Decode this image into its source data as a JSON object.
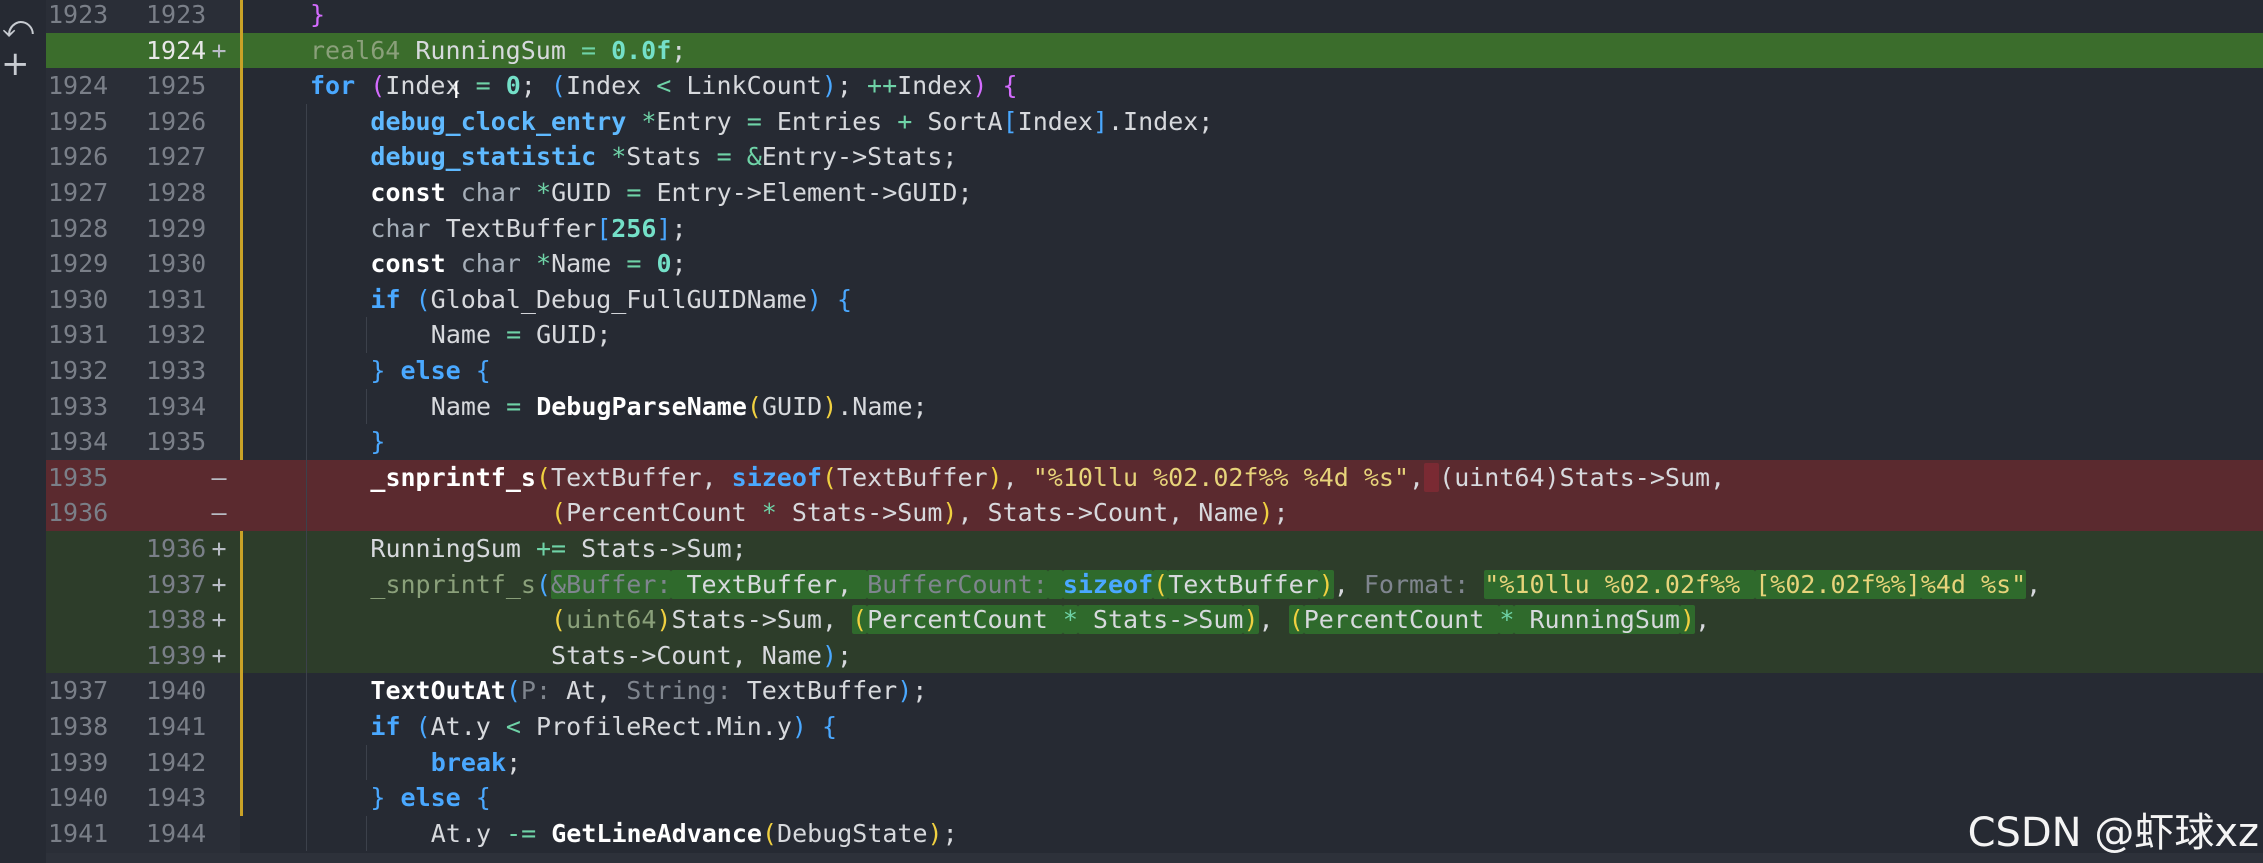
{
  "watermark": "CSDN @虾球xz",
  "icons": {
    "undo": "undo-icon",
    "add": "plus-icon",
    "text_cursor": "text-cursor-icon"
  },
  "colors": {
    "background": "#262a33",
    "added_line": "#2d3d2a",
    "added_line_active": "#3b6d2c",
    "removed_line": "#5b2a2f",
    "change_marker": "#c9a227",
    "keyword": "#4aa8ff",
    "string": "#e7d37a",
    "number": "#74e0c8"
  },
  "lines": [
    {
      "old": "1923",
      "new": "1923",
      "marker": "",
      "type": "context",
      "indent": 1,
      "tokens": [
        {
          "t": "}",
          "c": "par2"
        }
      ]
    },
    {
      "old": "",
      "new": "1924",
      "marker": "+",
      "type": "added-strong",
      "indent": 1,
      "cur": true,
      "tokens": [
        {
          "t": "real64",
          "c": "dim"
        },
        {
          "t": " RunningSum ",
          "c": "plain"
        },
        {
          "t": "=",
          "c": "op"
        },
        {
          "t": " ",
          "c": "plain"
        },
        {
          "t": "0.0f",
          "c": "num"
        },
        {
          "t": ";",
          "c": "plain"
        }
      ]
    },
    {
      "old": "1924",
      "new": "1925",
      "marker": "",
      "type": "context",
      "indent": 1,
      "tokens": [
        {
          "t": "for",
          "c": "kwb"
        },
        {
          "t": " ",
          "c": "plain"
        },
        {
          "t": "(",
          "c": "par2"
        },
        {
          "t": "Index ",
          "c": "plain"
        },
        {
          "t": "=",
          "c": "op"
        },
        {
          "t": " ",
          "c": "plain"
        },
        {
          "t": "0",
          "c": "num"
        },
        {
          "t": "; ",
          "c": "plain"
        },
        {
          "t": "(",
          "c": "brk"
        },
        {
          "t": "Index ",
          "c": "plain"
        },
        {
          "t": "<",
          "c": "op"
        },
        {
          "t": " LinkCount",
          "c": "plain"
        },
        {
          "t": ")",
          "c": "brk"
        },
        {
          "t": "; ",
          "c": "plain"
        },
        {
          "t": "++",
          "c": "op"
        },
        {
          "t": "Index",
          "c": "plain"
        },
        {
          "t": ")",
          "c": "par2"
        },
        {
          "t": " ",
          "c": "plain"
        },
        {
          "t": "{",
          "c": "par2"
        }
      ]
    },
    {
      "old": "1925",
      "new": "1926",
      "marker": "",
      "type": "context",
      "indent": 2,
      "tokens": [
        {
          "t": "debug_clock_entry",
          "c": "type"
        },
        {
          "t": " ",
          "c": "plain"
        },
        {
          "t": "*",
          "c": "op"
        },
        {
          "t": "Entry ",
          "c": "plain"
        },
        {
          "t": "=",
          "c": "op"
        },
        {
          "t": " Entries ",
          "c": "plain"
        },
        {
          "t": "+",
          "c": "op"
        },
        {
          "t": " SortA",
          "c": "plain"
        },
        {
          "t": "[",
          "c": "brk"
        },
        {
          "t": "Index",
          "c": "plain"
        },
        {
          "t": "]",
          "c": "brk"
        },
        {
          "t": ".Index;",
          "c": "plain"
        }
      ]
    },
    {
      "old": "1926",
      "new": "1927",
      "marker": "",
      "type": "context",
      "indent": 2,
      "tokens": [
        {
          "t": "debug_statistic",
          "c": "type"
        },
        {
          "t": " ",
          "c": "plain"
        },
        {
          "t": "*",
          "c": "op"
        },
        {
          "t": "Stats ",
          "c": "plain"
        },
        {
          "t": "=",
          "c": "op"
        },
        {
          "t": " ",
          "c": "plain"
        },
        {
          "t": "&",
          "c": "op"
        },
        {
          "t": "Entry->Stats;",
          "c": "plain"
        }
      ]
    },
    {
      "old": "1927",
      "new": "1928",
      "marker": "",
      "type": "context",
      "indent": 2,
      "tokens": [
        {
          "t": "const",
          "c": "fn"
        },
        {
          "t": " ",
          "c": "plain"
        },
        {
          "t": "char",
          "c": "sub"
        },
        {
          "t": " ",
          "c": "plain"
        },
        {
          "t": "*",
          "c": "op"
        },
        {
          "t": "GUID ",
          "c": "plain"
        },
        {
          "t": "=",
          "c": "op"
        },
        {
          "t": " Entry->Element->GUID;",
          "c": "plain"
        }
      ]
    },
    {
      "old": "1928",
      "new": "1929",
      "marker": "",
      "type": "context",
      "indent": 2,
      "tokens": [
        {
          "t": "char",
          "c": "sub"
        },
        {
          "t": " TextBuffer",
          "c": "plain"
        },
        {
          "t": "[",
          "c": "brk"
        },
        {
          "t": "256",
          "c": "num"
        },
        {
          "t": "]",
          "c": "brk"
        },
        {
          "t": ";",
          "c": "plain"
        }
      ]
    },
    {
      "old": "1929",
      "new": "1930",
      "marker": "",
      "type": "context",
      "indent": 2,
      "tokens": [
        {
          "t": "const",
          "c": "fn"
        },
        {
          "t": " ",
          "c": "plain"
        },
        {
          "t": "char",
          "c": "sub"
        },
        {
          "t": " ",
          "c": "plain"
        },
        {
          "t": "*",
          "c": "op"
        },
        {
          "t": "Name ",
          "c": "plain"
        },
        {
          "t": "=",
          "c": "op"
        },
        {
          "t": " ",
          "c": "plain"
        },
        {
          "t": "0",
          "c": "num"
        },
        {
          "t": ";",
          "c": "plain"
        }
      ]
    },
    {
      "old": "1930",
      "new": "1931",
      "marker": "",
      "type": "context",
      "indent": 2,
      "tokens": [
        {
          "t": "if",
          "c": "kwb"
        },
        {
          "t": " ",
          "c": "plain"
        },
        {
          "t": "(",
          "c": "brk"
        },
        {
          "t": "Global_Debug_FullGUIDName",
          "c": "plain"
        },
        {
          "t": ")",
          "c": "brk"
        },
        {
          "t": " ",
          "c": "plain"
        },
        {
          "t": "{",
          "c": "brk"
        }
      ]
    },
    {
      "old": "1931",
      "new": "1932",
      "marker": "",
      "type": "context",
      "indent": 3,
      "tokens": [
        {
          "t": "Name ",
          "c": "plain"
        },
        {
          "t": "=",
          "c": "op"
        },
        {
          "t": " GUID;",
          "c": "plain"
        }
      ]
    },
    {
      "old": "1932",
      "new": "1933",
      "marker": "",
      "type": "context",
      "indent": 2,
      "tokens": [
        {
          "t": "}",
          "c": "brk"
        },
        {
          "t": " ",
          "c": "plain"
        },
        {
          "t": "else",
          "c": "kwb"
        },
        {
          "t": " ",
          "c": "plain"
        },
        {
          "t": "{",
          "c": "brk"
        }
      ]
    },
    {
      "old": "1933",
      "new": "1934",
      "marker": "",
      "type": "context",
      "indent": 3,
      "tokens": [
        {
          "t": "Name ",
          "c": "plain"
        },
        {
          "t": "=",
          "c": "op"
        },
        {
          "t": " ",
          "c": "plain"
        },
        {
          "t": "DebugParseName",
          "c": "fn"
        },
        {
          "t": "(",
          "c": "par"
        },
        {
          "t": "GUID",
          "c": "plain"
        },
        {
          "t": ")",
          "c": "par"
        },
        {
          "t": ".Name;",
          "c": "plain"
        }
      ]
    },
    {
      "old": "1934",
      "new": "1935",
      "marker": "",
      "type": "context",
      "indent": 2,
      "tokens": [
        {
          "t": "}",
          "c": "brk"
        }
      ]
    },
    {
      "old": "1935",
      "new": "",
      "marker": "—",
      "type": "removed",
      "indent": 2,
      "tokens": [
        {
          "t": "_snprintf_s",
          "c": "fn"
        },
        {
          "t": "(",
          "c": "par"
        },
        {
          "t": "TextBuffer, ",
          "c": "plain"
        },
        {
          "t": "sizeof",
          "c": "kwb"
        },
        {
          "t": "(",
          "c": "par"
        },
        {
          "t": "TextBuffer",
          "c": "plain"
        },
        {
          "t": ")",
          "c": "par"
        },
        {
          "t": ", ",
          "c": "plain"
        },
        {
          "t": "\"%10llu %02.02f%% %4d %s\"",
          "c": "str"
        },
        {
          "t": ",",
          "c": "plain"
        },
        {
          "t": " ",
          "c": "plain",
          "hl": "r"
        },
        {
          "t": "(uint64)Stats->Sum,",
          "c": "plain"
        }
      ]
    },
    {
      "old": "1936",
      "new": "",
      "marker": "—",
      "type": "removed",
      "indent": 2,
      "tokens": [
        {
          "t": "            ",
          "c": "plain"
        },
        {
          "t": "(",
          "c": "par"
        },
        {
          "t": "PercentCount ",
          "c": "plain"
        },
        {
          "t": "*",
          "c": "op"
        },
        {
          "t": " Stats->Sum",
          "c": "plain"
        },
        {
          "t": ")",
          "c": "par"
        },
        {
          "t": ", Stats->Count, Name",
          "c": "plain"
        },
        {
          "t": ")",
          "c": "par"
        },
        {
          "t": ";",
          "c": "plain"
        }
      ]
    },
    {
      "old": "",
      "new": "1936",
      "marker": "+",
      "type": "added",
      "indent": 2,
      "tokens": [
        {
          "t": "RunningSum ",
          "c": "plain"
        },
        {
          "t": "+=",
          "c": "op"
        },
        {
          "t": " Stats->Sum;",
          "c": "plain"
        }
      ]
    },
    {
      "old": "",
      "new": "1937",
      "marker": "+",
      "type": "added",
      "indent": 2,
      "tokens": [
        {
          "t": "_snprintf_s",
          "c": "dim"
        },
        {
          "t": "(",
          "c": "brk"
        },
        {
          "t": "&Buffer:",
          "c": "hint",
          "hl": "g"
        },
        {
          "t": " TextBuffer, ",
          "c": "plain",
          "hl": "g"
        },
        {
          "t": "BufferCount:",
          "c": "hint",
          "hl": "g"
        },
        {
          "t": " ",
          "c": "plain",
          "hl": "g"
        },
        {
          "t": "sizeof",
          "c": "kwb",
          "hl": "g"
        },
        {
          "t": "(",
          "c": "par",
          "hl": "g"
        },
        {
          "t": "TextBuffer",
          "c": "plain",
          "hl": "g"
        },
        {
          "t": ")",
          "c": "par",
          "hl": "g"
        },
        {
          "t": ", ",
          "c": "plain"
        },
        {
          "t": "Format:",
          "c": "hint"
        },
        {
          "t": " ",
          "c": "plain"
        },
        {
          "t": "\"%10llu %02.02f%% ",
          "c": "str",
          "hl": "g"
        },
        {
          "t": "[%02.02f%%]",
          "c": "str",
          "hl": "g"
        },
        {
          "t": "%4d %s\"",
          "c": "str",
          "hl": "g"
        },
        {
          "t": ",",
          "c": "plain"
        }
      ]
    },
    {
      "old": "",
      "new": "1938",
      "marker": "+",
      "type": "added",
      "indent": 2,
      "tokens": [
        {
          "t": "            ",
          "c": "plain"
        },
        {
          "t": "(",
          "c": "par"
        },
        {
          "t": "uint64",
          "c": "dim"
        },
        {
          "t": ")",
          "c": "par"
        },
        {
          "t": "Stats->Sum, ",
          "c": "plain"
        },
        {
          "t": "(",
          "c": "par",
          "hl": "g"
        },
        {
          "t": "PercentCount ",
          "c": "plain",
          "hl": "g"
        },
        {
          "t": "*",
          "c": "op",
          "hl": "g"
        },
        {
          "t": " Stats->Sum",
          "c": "plain",
          "hl": "g"
        },
        {
          "t": ")",
          "c": "par",
          "hl": "g"
        },
        {
          "t": ", ",
          "c": "plain"
        },
        {
          "t": "(",
          "c": "par",
          "hl": "g"
        },
        {
          "t": "PercentCount ",
          "c": "plain",
          "hl": "g"
        },
        {
          "t": "*",
          "c": "op",
          "hl": "g"
        },
        {
          "t": " RunningSum",
          "c": "plain",
          "hl": "g"
        },
        {
          "t": ")",
          "c": "par",
          "hl": "g"
        },
        {
          "t": ",",
          "c": "plain"
        }
      ]
    },
    {
      "old": "",
      "new": "1939",
      "marker": "+",
      "type": "added",
      "indent": 2,
      "tokens": [
        {
          "t": "            ",
          "c": "plain"
        },
        {
          "t": "Stats->Count, Name",
          "c": "plain"
        },
        {
          "t": ")",
          "c": "brk"
        },
        {
          "t": ";",
          "c": "plain"
        }
      ]
    },
    {
      "old": "1937",
      "new": "1940",
      "marker": "",
      "type": "context",
      "indent": 2,
      "tokens": [
        {
          "t": "TextOutAt",
          "c": "fn"
        },
        {
          "t": "(",
          "c": "brk"
        },
        {
          "t": "P:",
          "c": "hint"
        },
        {
          "t": " At, ",
          "c": "plain"
        },
        {
          "t": "String:",
          "c": "hint"
        },
        {
          "t": " TextBuffer",
          "c": "plain"
        },
        {
          "t": ")",
          "c": "brk"
        },
        {
          "t": ";",
          "c": "plain"
        }
      ]
    },
    {
      "old": "1938",
      "new": "1941",
      "marker": "",
      "type": "context",
      "indent": 2,
      "tokens": [
        {
          "t": "if",
          "c": "kwb"
        },
        {
          "t": " ",
          "c": "plain"
        },
        {
          "t": "(",
          "c": "brk"
        },
        {
          "t": "At.y ",
          "c": "plain"
        },
        {
          "t": "<",
          "c": "op"
        },
        {
          "t": " ProfileRect.Min.y",
          "c": "plain"
        },
        {
          "t": ")",
          "c": "brk"
        },
        {
          "t": " ",
          "c": "plain"
        },
        {
          "t": "{",
          "c": "brk"
        }
      ]
    },
    {
      "old": "1939",
      "new": "1942",
      "marker": "",
      "type": "context",
      "indent": 3,
      "tokens": [
        {
          "t": "break",
          "c": "kwb"
        },
        {
          "t": ";",
          "c": "plain"
        }
      ]
    },
    {
      "old": "1940",
      "new": "1943",
      "marker": "",
      "type": "context",
      "indent": 2,
      "tokens": [
        {
          "t": "}",
          "c": "brk"
        },
        {
          "t": " ",
          "c": "plain"
        },
        {
          "t": "else",
          "c": "kwb"
        },
        {
          "t": " ",
          "c": "plain"
        },
        {
          "t": "{",
          "c": "brk"
        }
      ]
    },
    {
      "old": "1941",
      "new": "1944",
      "marker": "",
      "type": "context",
      "indent": 3,
      "tokens": [
        {
          "t": "At.y ",
          "c": "plain"
        },
        {
          "t": "-=",
          "c": "op"
        },
        {
          "t": " ",
          "c": "plain"
        },
        {
          "t": "GetLineAdvance",
          "c": "fn"
        },
        {
          "t": "(",
          "c": "par"
        },
        {
          "t": "DebugState",
          "c": "plain"
        },
        {
          "t": ")",
          "c": "par"
        },
        {
          "t": ";",
          "c": "plain"
        }
      ]
    }
  ]
}
